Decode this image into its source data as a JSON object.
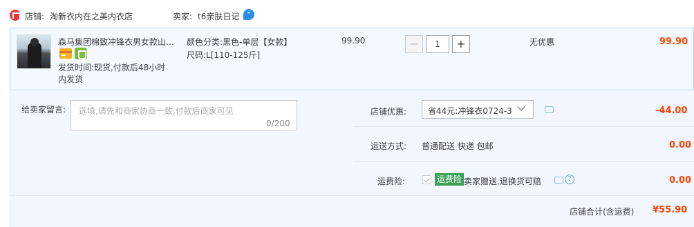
{
  "shop": {
    "label": "店铺:",
    "name": "淘新衣内在之美内衣店",
    "seller_label": "卖家:",
    "seller_name": "t6亲肤日记"
  },
  "item": {
    "title": "森马集团棉致冲锋衣男女款山系…",
    "ship_line1": "发货时间:现货,付款后48小时",
    "ship_line2": "内发货",
    "color": "颜色分类:黑色-单层【女款】",
    "size": "尺码:L[110-125斤]",
    "unit_price": "99.90",
    "quantity": "1",
    "discount": "无优惠",
    "line_total": "99.90"
  },
  "message": {
    "label": "给卖家留言:",
    "placeholder": "选填,请先和商家协商一致,付款后商家可见",
    "count": "0/200"
  },
  "coupon": {
    "label": "店铺优惠:",
    "selected": "省44元:冲锋衣0724-3",
    "amount": "-44.00"
  },
  "delivery": {
    "label": "运送方式:",
    "value": "普通配送 快递 包邮",
    "price": "0.00"
  },
  "insurance": {
    "label": "运费险:",
    "tag": "运费险",
    "text": "卖家赠送,退换货可赔",
    "price": "0.00"
  },
  "total": {
    "label": "店铺合计(含运费)",
    "value": "¥55.90"
  },
  "colors": {
    "accent": "#ff4400",
    "insurance_tag": "#3ba156",
    "row_bg": "#f3f9ff"
  }
}
